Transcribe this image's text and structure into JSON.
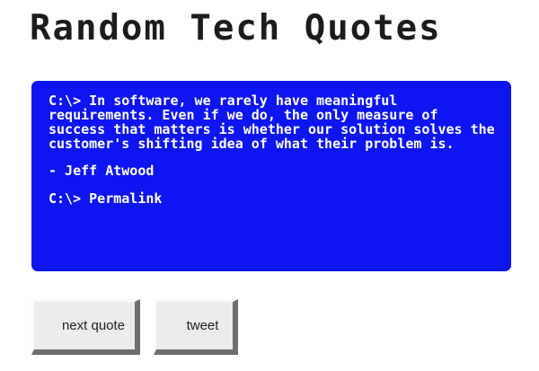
{
  "header": {
    "title": "Random Tech Quotes"
  },
  "quote": {
    "text": "C:\\> In software, we rarely have meaningful requirements. Even if we do, the only measure of success that matters is whether our solution solves the customer's shifting idea of what their problem is.",
    "author": "- Jeff Atwood",
    "permalink_label": "C:\\> Permalink"
  },
  "buttons": {
    "next_label": "next quote",
    "tweet_label": "tweet"
  },
  "colors": {
    "quote_background": "#0d15f0",
    "quote_text": "#ffffff",
    "title_text": "#1c1c1c"
  }
}
